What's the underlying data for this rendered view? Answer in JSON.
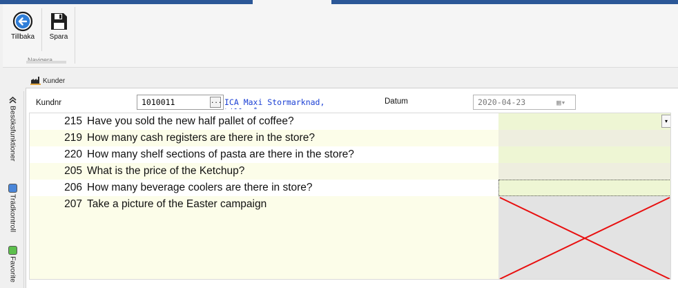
{
  "ribbon": {
    "back_label": "Tillbaka",
    "save_label": "Spara",
    "group_label": "Navigera"
  },
  "breadcrumb": {
    "label": "Kunder"
  },
  "rail": {
    "tab1": "Besöksfunktioner",
    "tab2": "Trädkontroll",
    "tab3": "Favorite"
  },
  "form": {
    "kundnr_label": "Kundnr",
    "kundnr_value": "1010011",
    "browse_label": "...",
    "customer_name": "ICA Maxi Stormarknad, Lilla Å",
    "datum_label": "Datum",
    "datum_value": "2020-04-23"
  },
  "questions": [
    {
      "id": "215",
      "text": "Have you sold the new half pallet of coffee?",
      "answer_type": "dropdown"
    },
    {
      "id": "219",
      "text": "How many cash registers are there in the store?",
      "answer_type": "number"
    },
    {
      "id": "220",
      "text": "How many shelf sections of pasta are there in the store?",
      "answer_type": "number"
    },
    {
      "id": "205",
      "text": "What is the price of the Ketchup?",
      "answer_type": "number"
    },
    {
      "id": "206",
      "text": "How many beverage coolers are there in store?",
      "answer_type": "number"
    },
    {
      "id": "207",
      "text": "Take a picture of the Easter campaign",
      "answer_type": "image"
    }
  ],
  "colors": {
    "title_bar": "#2b5797",
    "row_light": "#fcfde9",
    "answer_green": "#eef6d4",
    "answer_gray": "#eeeedf",
    "link_blue": "#1a3fd4",
    "placeholder_x": "#e81010"
  },
  "icons": {
    "back": "arrow-left-circle-icon",
    "save": "floppy-disk-icon",
    "kunder": "factory-icon",
    "calendar": "calendar-icon",
    "image_placeholder": "missing-image-x-icon"
  }
}
